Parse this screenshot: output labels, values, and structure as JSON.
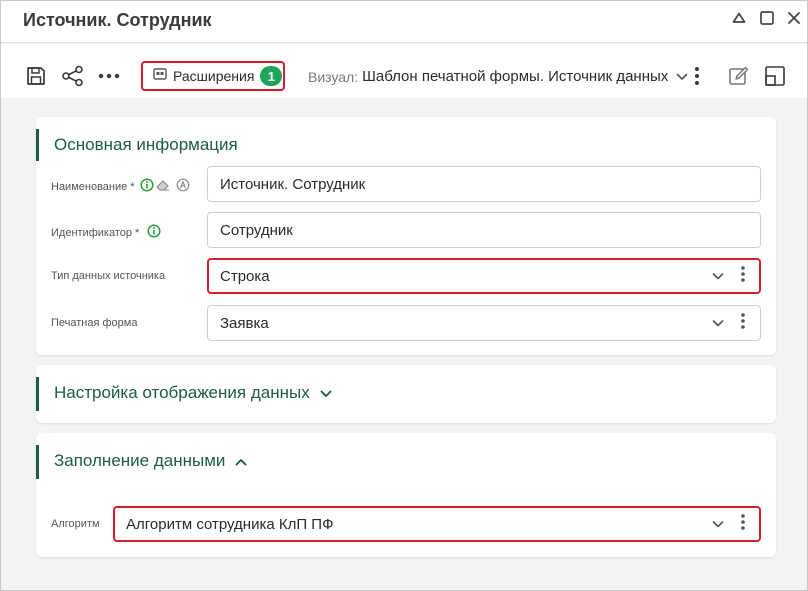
{
  "window": {
    "title": "Источник. Сотрудник"
  },
  "toolbar": {
    "extensions_label": "Расширения",
    "extensions_count": "1",
    "visual_prefix": "Визуал:",
    "visual_value": "Шаблон печатной формы. Источник данных"
  },
  "sections": {
    "basic": {
      "title": "Основная информация",
      "fields": {
        "name_label": "Наименование *",
        "name_value": "Источник. Сотрудник",
        "id_label": "Идентификатор *",
        "id_value": "Сотрудник",
        "type_label": "Тип данных источника",
        "type_value": "Строка",
        "form_label": "Печатная форма",
        "form_value": "Заявка"
      }
    },
    "display": {
      "title": "Настройка отображения данных"
    },
    "fill": {
      "title": "Заполнение данными",
      "algorithm_label": "Алгоритм",
      "algorithm_value": "Алгоритм сотрудника КлП ПФ"
    }
  },
  "colors": {
    "accent": "#1e5c45",
    "highlight": "#d0202e",
    "badge": "#1fa65a",
    "info": "#2a9d3a"
  },
  "icons": [
    "save-icon",
    "share-graph-icon",
    "more-horizontal-icon",
    "extensions-icon",
    "chevron-down-icon",
    "more-vertical-icon",
    "edit-icon",
    "layout-icon",
    "collapse-icon",
    "maximize-icon",
    "close-icon",
    "info-icon",
    "eraser-icon",
    "translate-icon",
    "chevron-up-icon"
  ]
}
